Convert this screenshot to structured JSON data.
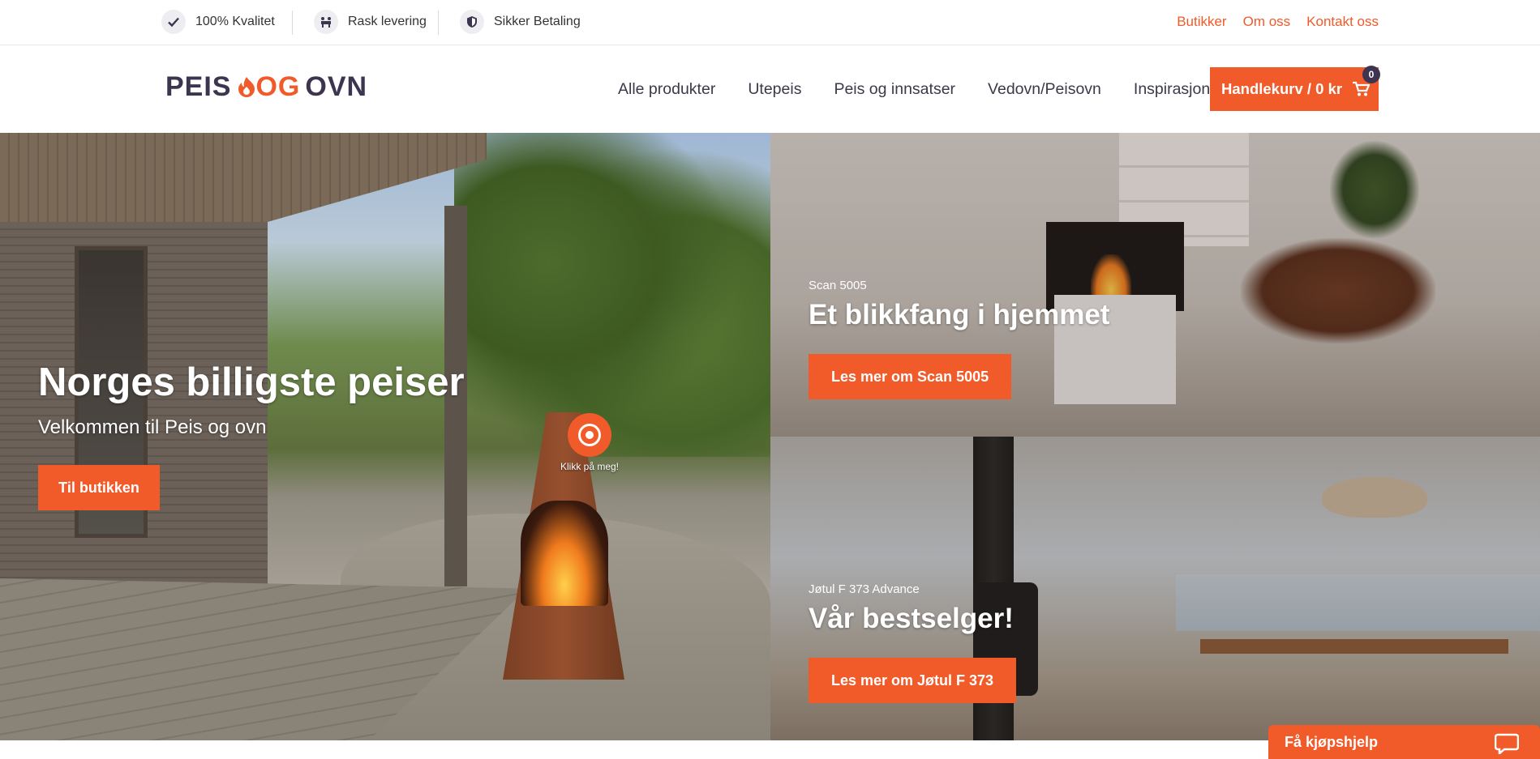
{
  "topbar": {
    "usps": [
      {
        "label": "100% Kvalitet",
        "icon": "check-icon"
      },
      {
        "label": "Rask levering",
        "icon": "delivery-icon"
      },
      {
        "label": "Sikker Betaling",
        "icon": "shield-icon"
      }
    ],
    "links": [
      "Butikker",
      "Om oss",
      "Kontakt oss"
    ]
  },
  "header": {
    "logo": {
      "part1": "PEIS",
      "part2": "OG",
      "part3": "OVN"
    },
    "nav": [
      "Alle produkter",
      "Utepeis",
      "Peis og innsatser",
      "Vedovn/Peisovn",
      "Inspirasjon"
    ],
    "cart": {
      "label": "Handlekurv / 0 kr",
      "count": "0",
      "icon": "cart-icon"
    }
  },
  "hero": {
    "title": "Norges billigste peiser",
    "subtitle": "Velkommen til Peis og ovn",
    "button": "Til butikken",
    "hotspot_label": "Klikk på meg!"
  },
  "panels": [
    {
      "pre": "Scan 5005",
      "title": "Et blikkfang i hjemmet",
      "button": "Les mer om Scan 5005"
    },
    {
      "pre": "Jøtul F 373 Advance",
      "title": "Vår bestselger!",
      "button": "Les mer om Jøtul F 373"
    }
  ],
  "help": {
    "label": "Få kjøpshjelp",
    "icon": "chat-icon"
  },
  "colors": {
    "accent": "#f15a29",
    "dark": "#3d3550"
  }
}
